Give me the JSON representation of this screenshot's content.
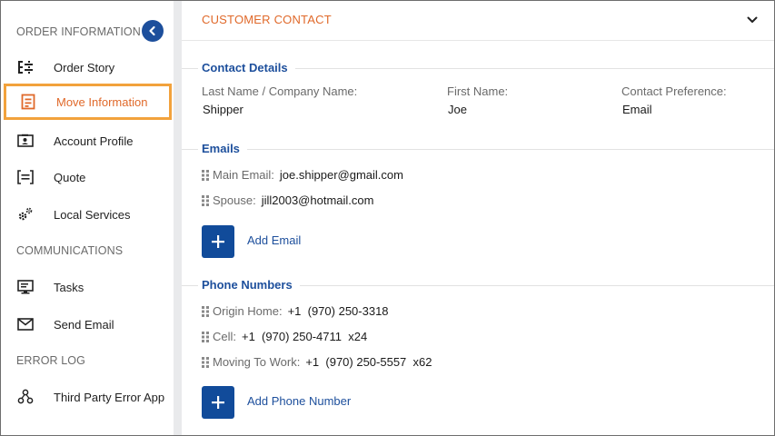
{
  "sidebar": {
    "sections": {
      "order_information": "ORDER INFORMATION",
      "communications": "COMMUNICATIONS",
      "error_log": "ERROR LOG"
    },
    "items": [
      {
        "label": "Order Story",
        "icon": "timeline-icon"
      },
      {
        "label": "Move Information",
        "icon": "document-icon",
        "active": true
      },
      {
        "label": "Account Profile",
        "icon": "id-card-icon"
      },
      {
        "label": "Quote",
        "icon": "quote-icon"
      },
      {
        "label": "Local Services",
        "icon": "gears-icon"
      },
      {
        "label": "Tasks",
        "icon": "monitor-icon"
      },
      {
        "label": "Send Email",
        "icon": "envelope-icon"
      },
      {
        "label": "Third Party Error App",
        "icon": "network-icon"
      }
    ],
    "collapse_icon": "chevron-left-icon"
  },
  "panel": {
    "title": "CUSTOMER CONTACT",
    "toggle_icon": "chevron-down-icon"
  },
  "contact_details": {
    "title": "Contact Details",
    "fields": [
      {
        "label": "Last Name / Company Name:",
        "value": "Shipper"
      },
      {
        "label": "First Name:",
        "value": "Joe"
      },
      {
        "label": "Contact Preference:",
        "value": "Email"
      }
    ]
  },
  "emails": {
    "title": "Emails",
    "items": [
      {
        "label": "Main Email:",
        "value": "joe.shipper@gmail.com"
      },
      {
        "label": "Spouse:",
        "value": "jill2003@hotmail.com"
      }
    ],
    "add_label": "Add Email"
  },
  "phones": {
    "title": "Phone Numbers",
    "items": [
      {
        "label": "Origin Home:",
        "value": "+1  (970) 250-3318"
      },
      {
        "label": "Cell:",
        "value": "+1  (970) 250-4711  x24"
      },
      {
        "label": "Moving To Work:",
        "value": "+1  (970) 250-5557  x62"
      }
    ],
    "add_label": "Add Phone Number"
  },
  "colors": {
    "accent_orange": "#e0692a",
    "active_border": "#f2a23c",
    "primary_blue": "#114b9a"
  }
}
